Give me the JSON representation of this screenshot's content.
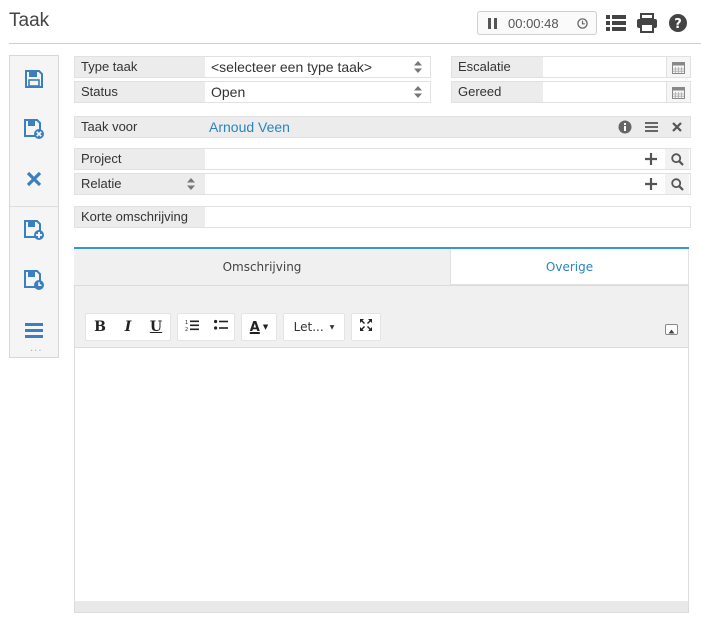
{
  "header": {
    "title": "Taak",
    "timer": "00:00:48"
  },
  "form": {
    "type_taak": {
      "label": "Type taak",
      "value": "<selecteer een type taak>"
    },
    "status": {
      "label": "Status",
      "value": "Open"
    },
    "escalatie": {
      "label": "Escalatie",
      "value": ""
    },
    "gereed": {
      "label": "Gereed",
      "value": ""
    },
    "taak_voor": {
      "label": "Taak voor",
      "value": "Arnoud Veen"
    },
    "project": {
      "label": "Project",
      "value": ""
    },
    "relatie": {
      "label": "Relatie",
      "value": ""
    },
    "korte_omschrijving": {
      "label": "Korte omschrijving",
      "value": ""
    }
  },
  "tabs": [
    {
      "label": "Omschrijving",
      "active": true
    },
    {
      "label": "Overige",
      "active": false
    }
  ],
  "editor": {
    "bold": "B",
    "italic": "I",
    "underline": "U",
    "font_color": "A",
    "font_select": "Let...",
    "content": ""
  },
  "colors": {
    "accent": "#2a84c0",
    "label_bg": "#ececec",
    "icon": "#3a7fc0"
  }
}
